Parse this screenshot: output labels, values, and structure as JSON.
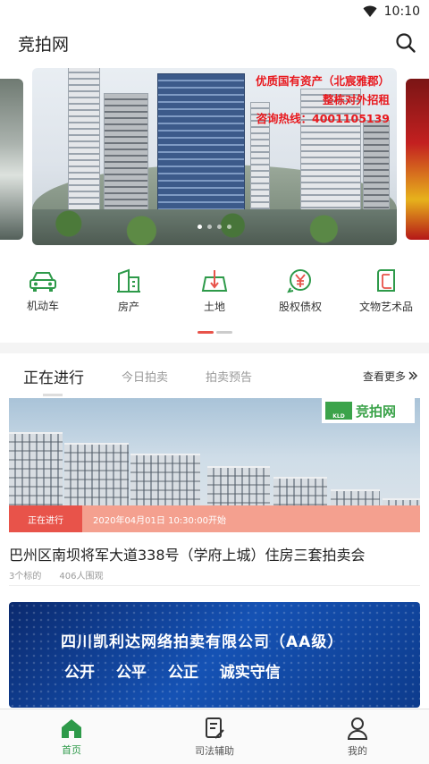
{
  "status": {
    "time": "10:10"
  },
  "app": {
    "title": "竞拍网"
  },
  "banner": {
    "lines": [
      "优质国有资产（北宸雅郡）",
      "整栋对外招租",
      "咨询热线：4001105139"
    ]
  },
  "categories": [
    {
      "label": "机动车",
      "icon": "car-icon"
    },
    {
      "label": "房产",
      "icon": "building-icon"
    },
    {
      "label": "土地",
      "icon": "land-icon"
    },
    {
      "label": "股权债权",
      "icon": "yuan-icon"
    },
    {
      "label": "文物艺术品",
      "icon": "artwork-icon"
    }
  ],
  "tabs": [
    {
      "label": "正在进行",
      "active": true
    },
    {
      "label": "今日拍卖",
      "active": false
    },
    {
      "label": "拍卖预告",
      "active": false
    }
  ],
  "more_label": "查看更多",
  "auction": {
    "logo_text": "竞拍网",
    "logo_sub": "KLD",
    "badge": "正在进行",
    "start_time": "2020年04月01日 10:30:00开始",
    "title": "巴州区南坝将军大道338号（学府上城）住房三套拍卖会",
    "lots": "3个标的",
    "viewers": "406人围观"
  },
  "promo": {
    "line1": "四川凯利达网络拍卖有限公司（AA级）",
    "line2": "公开 公平 公正 诚实守信"
  },
  "bottom_nav": [
    {
      "label": "首页",
      "icon": "home-icon",
      "active": true
    },
    {
      "label": "司法辅助",
      "icon": "document-icon",
      "active": false
    },
    {
      "label": "我的",
      "icon": "user-icon",
      "active": false
    }
  ],
  "colors": {
    "green": "#2e9a4a",
    "red": "#e8534a",
    "banner_text": "#e8191e"
  }
}
